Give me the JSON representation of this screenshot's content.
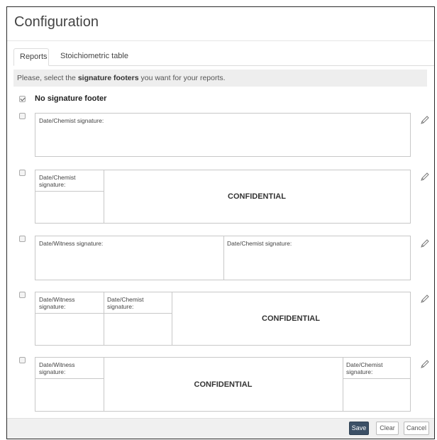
{
  "dialog": {
    "title": "Configuration"
  },
  "tabs": [
    {
      "label": "Reports",
      "active": true
    },
    {
      "label": "Stoichiometric table",
      "active": false
    }
  ],
  "info": {
    "prefix": "Please, select the ",
    "bold": "signature footers",
    "suffix": " you want for your reports."
  },
  "options": {
    "no_footer": {
      "label": "No signature footer",
      "checked": true
    },
    "footer1": {
      "checked": false,
      "date_chemist": "Date/Chemist signature:"
    },
    "footer2": {
      "checked": false,
      "date_chemist": "Date/Chemist signature:",
      "confidential": "CONFIDENTIAL"
    },
    "footer3": {
      "checked": false,
      "date_witness": "Date/Witness signature:",
      "date_chemist": "Date/Chemist signature:"
    },
    "footer4": {
      "checked": false,
      "date_witness": "Date/Witness signature:",
      "date_chemist": "Date/Chemist signature:",
      "confidential": "CONFIDENTIAL"
    },
    "footer5": {
      "checked": false,
      "date_witness": "Date/Witness signature:",
      "date_chemist": "Date/Chemist signature:",
      "confidential": "CONFIDENTIAL"
    }
  },
  "buttons": {
    "save": "Save",
    "clear": "Clear",
    "cancel": "Cancel"
  },
  "icons": {
    "edit": "pencil-icon"
  },
  "colors": {
    "save_button": "#3c5066",
    "info_bar": "#eeeeee"
  }
}
